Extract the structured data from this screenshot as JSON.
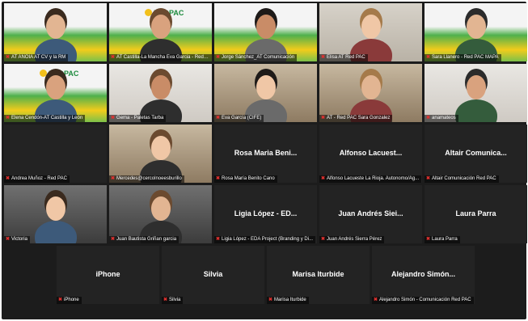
{
  "participants": [
    {
      "name": "AT ANOIA AT CV y la RM",
      "kind": "video",
      "scene": "slide",
      "logo": ""
    },
    {
      "name": "AT Castilla-La Mancha Eva Garcia - Red PAC",
      "kind": "video",
      "scene": "slide",
      "logo": "REDPAC"
    },
    {
      "name": "Jorge Sánchez_AT Comunicación",
      "kind": "video",
      "scene": "slide",
      "logo": ""
    },
    {
      "name": "Elisa AT Red PAC",
      "kind": "video",
      "scene": "room-light",
      "logo": ""
    },
    {
      "name": "Sara Llanero - Red PAC MAPA",
      "kind": "video",
      "scene": "slide",
      "logo": ""
    },
    {
      "name": "Elena Cendón-AT Castilla y León",
      "kind": "video",
      "scene": "slide",
      "logo": "REDPAC"
    },
    {
      "name": "Gema - Paletas Tarba",
      "kind": "video",
      "scene": "room-white",
      "logo": ""
    },
    {
      "name": "Eva García (CIFE)",
      "kind": "video",
      "scene": "room-warm",
      "logo": ""
    },
    {
      "name": "AT - Red PAC Sara Gonzalez",
      "kind": "video",
      "scene": "room-warm",
      "logo": ""
    },
    {
      "name": "anamateos",
      "kind": "video",
      "scene": "room-white",
      "logo": ""
    },
    {
      "name": "Andrea Muñoz - Red PAC",
      "kind": "name",
      "title": ""
    },
    {
      "name": "Mercedes@cercolnoeesburillo",
      "kind": "video",
      "scene": "room-warm",
      "logo": ""
    },
    {
      "name": "Rosa María Benito Cano",
      "kind": "name",
      "title": "Rosa Maria Beni..."
    },
    {
      "name": "Alfonso Lacueste La Rioja. Autonomo/Ag...",
      "kind": "name",
      "title": "Alfonso Lacuest..."
    },
    {
      "name": "Altair Comunicación Red PAC",
      "kind": "name",
      "title": "Altair Comunica..."
    },
    {
      "name": "Victoria",
      "kind": "video",
      "scene": "room-dark",
      "logo": ""
    },
    {
      "name": "Juan Bautista Griñan garcia",
      "kind": "video",
      "scene": "room-dark",
      "logo": ""
    },
    {
      "name": "Ligia López - EDA Project (Branding y Di...",
      "kind": "name",
      "title": "Ligia López - ED..."
    },
    {
      "name": "Juan Andrés Sierra Pérez",
      "kind": "name",
      "title": "Juan Andrés Siei..."
    },
    {
      "name": "Laura Parra",
      "kind": "name",
      "title": "Laura Parra"
    },
    {
      "name": "iPhone",
      "kind": "name",
      "title": "iPhone"
    },
    {
      "name": "Silvia",
      "kind": "name",
      "title": "Silvia"
    },
    {
      "name": "Marisa Iturbide",
      "kind": "name",
      "title": "Marisa Iturbide"
    },
    {
      "name": "Alejandro Simón - Comunicación Red PAC",
      "kind": "name",
      "title": "Alejandro Simón..."
    }
  ],
  "colors": {
    "muted_mic": "#e0312f",
    "tile_bg": "#232323",
    "grid_bg": "#1c1c1c"
  }
}
